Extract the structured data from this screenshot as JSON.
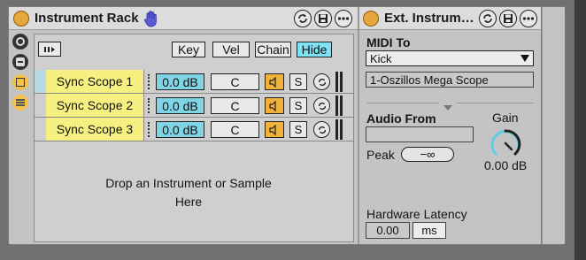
{
  "rack": {
    "title": "Instrument Rack",
    "hand_icon": "hand-icon",
    "buttons": {
      "key": "Key",
      "vel": "Vel",
      "chain": "Chain",
      "hide": "Hide"
    },
    "chains": [
      {
        "name": "Sync Scope 1",
        "volume": "0.0 dB",
        "pan": "C",
        "solo": "S"
      },
      {
        "name": "Sync Scope 2",
        "volume": "0.0 dB",
        "pan": "C",
        "solo": "S"
      },
      {
        "name": "Sync Scope 3",
        "volume": "0.0 dB",
        "pan": "C",
        "solo": "S"
      }
    ],
    "drop_line1": "Drop an Instrument or Sample",
    "drop_line2": "Here"
  },
  "ext": {
    "title": "Ext. Instrum…",
    "midi_to_label": "MIDI To",
    "midi_to_value": "Kick",
    "midi_to_sub": "1-Oszillos Mega Scope",
    "audio_from_label": "Audio From",
    "peak_label": "Peak",
    "peak_value": "−∞",
    "gain_label": "Gain",
    "gain_value": "0.00 dB",
    "latency_label": "Hardware Latency",
    "latency_value": "0.00",
    "latency_unit": "ms"
  },
  "colors": {
    "accent": "#e7a53e",
    "chain_yellow": "#f5f07f",
    "cyan": "#7de3f4"
  }
}
